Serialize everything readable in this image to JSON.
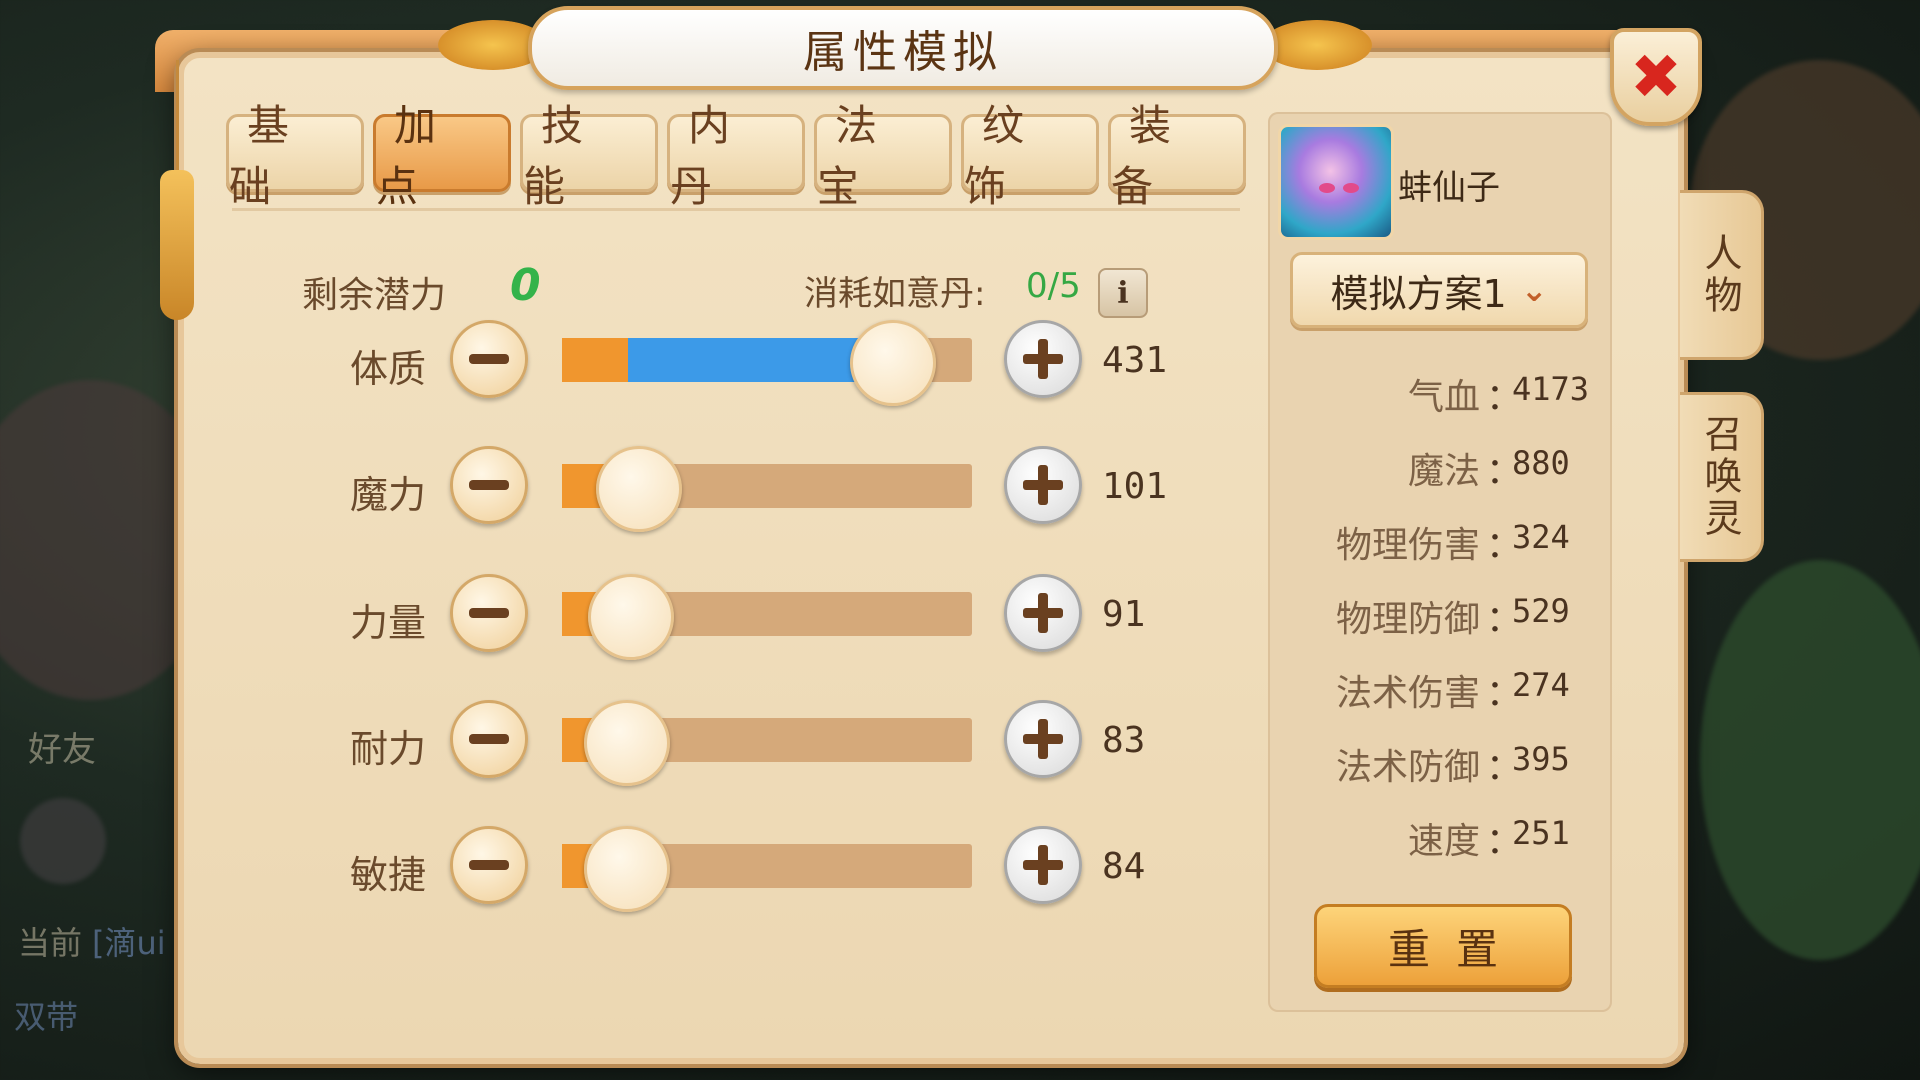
{
  "window": {
    "title": "属性模拟",
    "close_icon": "✖"
  },
  "tabs": [
    {
      "label": "基础",
      "active": false
    },
    {
      "label": "加点",
      "active": true
    },
    {
      "label": "技能",
      "active": false
    },
    {
      "label": "内丹",
      "active": false
    },
    {
      "label": "法宝",
      "active": false
    },
    {
      "label": "纹饰",
      "active": false
    },
    {
      "label": "装备",
      "active": false
    }
  ],
  "potential": {
    "label": "剩余潜力",
    "value": "0",
    "pill_label": "消耗如意丹:",
    "pill_value": "0/5",
    "info_icon": "i"
  },
  "stats": [
    {
      "name": "体质",
      "value": "431",
      "level": 0.8,
      "added": true
    },
    {
      "name": "魔力",
      "value": "101",
      "level": 0.18,
      "added": false
    },
    {
      "name": "力量",
      "value": "91",
      "level": 0.16,
      "added": false
    },
    {
      "name": "耐力",
      "value": "83",
      "level": 0.15,
      "added": false
    },
    {
      "name": "敏捷",
      "value": "84",
      "level": 0.15,
      "added": false
    }
  ],
  "character": {
    "name": "蚌仙子",
    "plan_label": "模拟方案1"
  },
  "attributes": [
    {
      "name": "气血",
      "value": "4173"
    },
    {
      "name": "魔法",
      "value": "880"
    },
    {
      "name": "物理伤害",
      "value": "324"
    },
    {
      "name": "物理防御",
      "value": "529"
    },
    {
      "name": "法术伤害",
      "value": "274"
    },
    {
      "name": "法术防御",
      "value": "395"
    },
    {
      "name": "速度",
      "value": "251"
    }
  ],
  "attr_colon": "：",
  "reset_label": "重置",
  "side_tabs": [
    {
      "label": "人物"
    },
    {
      "label": "召唤灵"
    }
  ],
  "background_text": {
    "friends": "好友",
    "channel": "当前",
    "chat": "[滴ui",
    "double": "双带"
  },
  "colors": {
    "accent_orange": "#f0962e",
    "accent_blue": "#3c9ae8",
    "green_value": "#34b34a",
    "close_red": "#d8261e"
  }
}
